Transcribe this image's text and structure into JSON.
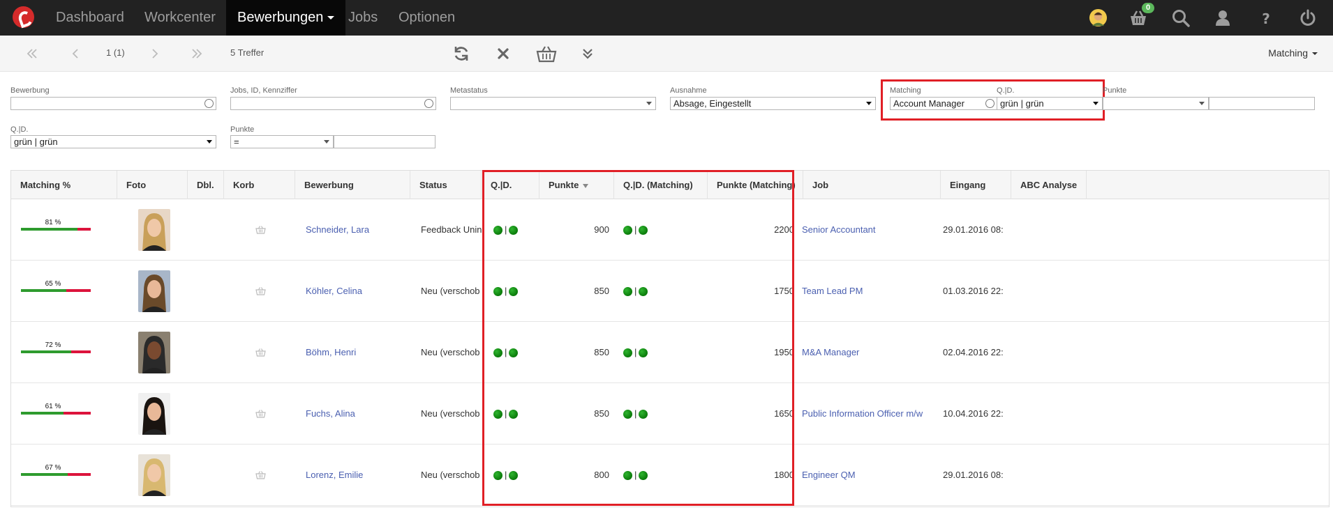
{
  "nav": {
    "items": [
      "Dashboard",
      "Workcenter",
      "Bewerbungen",
      "Jobs",
      "Optionen"
    ],
    "active": "Bewerbungen",
    "basket_count": "0",
    "icons": [
      "avatar",
      "basket-icon",
      "search-icon",
      "user-icon",
      "help-icon",
      "power-icon"
    ]
  },
  "toolbar": {
    "page_indicator": "1 (1)",
    "hits": "5 Treffer",
    "right_menu": "Matching"
  },
  "filters": {
    "bewerbung": {
      "label": "Bewerbung",
      "value": ""
    },
    "jobs": {
      "label": "Jobs, ID, Kennziffer",
      "value": ""
    },
    "metastatus": {
      "label": "Metastatus",
      "value": ""
    },
    "ausnahme": {
      "label": "Ausnahme",
      "value": "Absage, Eingestellt"
    },
    "matching": {
      "label": "Matching",
      "value": "Account Manager"
    },
    "qd_matching": {
      "label": "Q.|D.",
      "value": "grün | grün"
    },
    "punkte_matching": {
      "label": "Punkte",
      "value": ""
    },
    "qd": {
      "label": "Q.|D.",
      "value": "grün | grün"
    },
    "punkte": {
      "label": "Punkte",
      "operator": "=",
      "value": ""
    }
  },
  "table": {
    "columns": [
      "Matching %",
      "Foto",
      "Dbl.",
      "Korb",
      "Bewerbung",
      "Status",
      "Q.|D.",
      "Punkte",
      "Q.|D. (Matching)",
      "Punkte (Matching)",
      "Job",
      "Eingang",
      "ABC Analyse"
    ],
    "sort_column": "Punkte",
    "rows": [
      {
        "matching": "81 %",
        "matching_value": 81,
        "name": "Schneider, Lara",
        "status": "Feedback Unin",
        "punkte": "900",
        "punkte_matching": "2200",
        "job": "Senior Accountant",
        "eingang": "29.01.2016 08:"
      },
      {
        "matching": "65 %",
        "matching_value": 65,
        "name": "Köhler, Celina",
        "status": "Neu (verschob",
        "punkte": "850",
        "punkte_matching": "1750",
        "job": "Team Lead PM",
        "eingang": "01.03.2016 22:"
      },
      {
        "matching": "72 %",
        "matching_value": 72,
        "name": "Böhm, Henri",
        "status": "Neu (verschob",
        "punkte": "850",
        "punkte_matching": "1950",
        "job": "M&A Manager",
        "eingang": "02.04.2016 22:"
      },
      {
        "matching": "61 %",
        "matching_value": 61,
        "name": "Fuchs, Alina",
        "status": "Neu (verschob",
        "punkte": "850",
        "punkte_matching": "1650",
        "job": "Public Information Officer m/w",
        "eingang": "10.04.2016 22:"
      },
      {
        "matching": "67 %",
        "matching_value": 67,
        "name": "Lorenz, Emilie",
        "status": "Neu (verschob",
        "punkte": "800",
        "punkte_matching": "1800",
        "job": "Engineer QM",
        "eingang": "29.01.2016 08:"
      }
    ]
  },
  "colors": {
    "highlight": "#e01f26",
    "link": "#4a5fb0",
    "status_green": "#1a8f1a",
    "bar_green": "#2e9b2e",
    "bar_red": "#dc143c"
  }
}
